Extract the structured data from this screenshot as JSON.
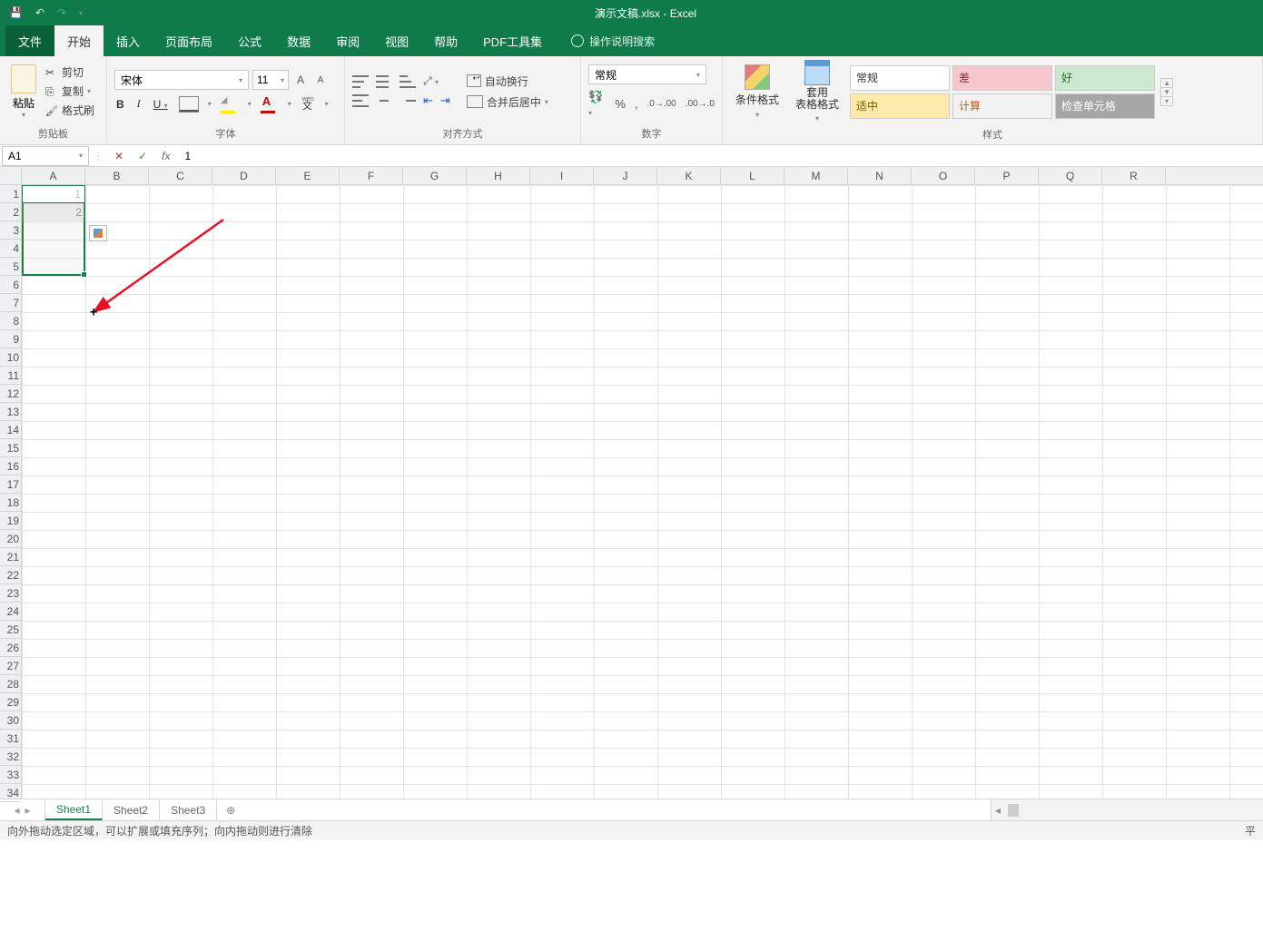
{
  "title": "演示文稿.xlsx  -  Excel",
  "tabs": {
    "file": "文件",
    "home": "开始",
    "insert": "插入",
    "layout": "页面布局",
    "formulas": "公式",
    "data": "数据",
    "review": "审阅",
    "view": "视图",
    "help": "帮助",
    "pdf": "PDF工具集",
    "tell": "操作说明搜索"
  },
  "clipboard": {
    "paste": "粘贴",
    "cut": "剪切",
    "copy": "复制",
    "painter": "格式刷",
    "group": "剪贴板"
  },
  "font": {
    "name": "宋体",
    "size": "11",
    "group": "字体"
  },
  "align": {
    "wrap": "自动换行",
    "merge": "合并后居中",
    "group": "对齐方式"
  },
  "number": {
    "format": "常规",
    "group": "数字"
  },
  "styles": {
    "cond": "条件格式",
    "table": "套用\n表格格式",
    "normal": "常规",
    "bad": "差",
    "good": "好",
    "neutral": "适中",
    "calc": "计算",
    "check": "检查单元格",
    "group": "样式"
  },
  "namebox": "A1",
  "formula": "1",
  "columns": [
    "A",
    "B",
    "C",
    "D",
    "E",
    "F",
    "G",
    "H",
    "I",
    "J",
    "K",
    "L",
    "M",
    "N",
    "O",
    "P",
    "Q",
    "R"
  ],
  "rows": [
    "1",
    "2",
    "3",
    "4",
    "5",
    "6",
    "7",
    "8",
    "9",
    "10",
    "11",
    "12",
    "13",
    "14",
    "15",
    "16",
    "17",
    "18",
    "19",
    "20",
    "21",
    "22",
    "23",
    "24",
    "25",
    "26",
    "27",
    "28",
    "29",
    "30",
    "31",
    "32",
    "33",
    "34"
  ],
  "cells": {
    "A1": "1",
    "A2": "2"
  },
  "sheets": {
    "s1": "Sheet1",
    "s2": "Sheet2",
    "s3": "Sheet3"
  },
  "status": "向外拖动选定区域，可以扩展或填充序列；向内拖动则进行清除",
  "status_right": "平"
}
